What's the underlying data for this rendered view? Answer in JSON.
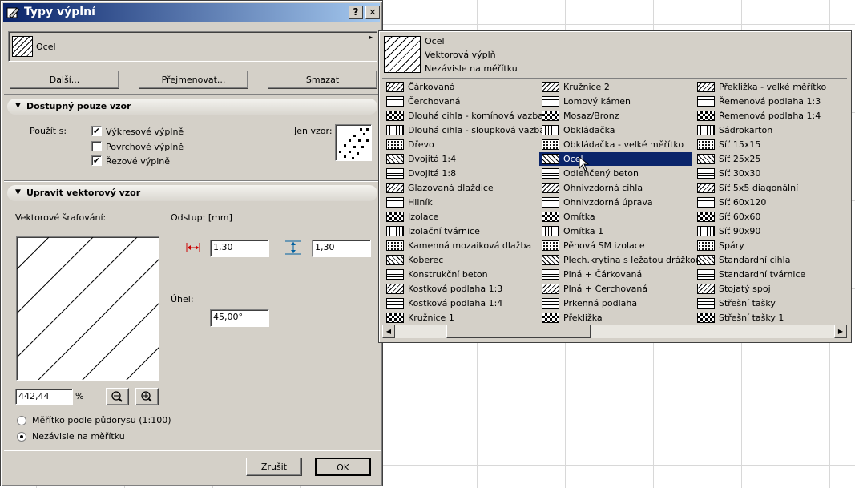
{
  "window": {
    "title": "Typy výplní",
    "help_btn": "?",
    "close_btn": "✕"
  },
  "current_fill": {
    "name": "Ocel"
  },
  "buttons": {
    "other": "Další...",
    "rename": "Přejmenovat...",
    "delete": "Smazat",
    "cancel": "Zrušit",
    "ok": "OK"
  },
  "section_pattern": {
    "header": "Dostupný pouze vzor",
    "use_with": "Použít s:",
    "options": [
      {
        "label": "Výkresové výplně",
        "checked": true
      },
      {
        "label": "Povrchové výplně",
        "checked": false
      },
      {
        "label": "Řezové výplně",
        "checked": true
      }
    ],
    "pattern_only": "Jen vzor:"
  },
  "section_vector": {
    "header": "Upravit vektorový vzor",
    "hatching_label": "Vektorové šrafování:",
    "offset_label": "Odstup: [mm]",
    "offset_x": "1,30",
    "offset_y": "1,30",
    "angle_label": "Úhel:",
    "angle": "45,00°",
    "zoom": "442,44",
    "zoom_unit": "%",
    "radio_scale": "Měřítko podle půdorysu (1:100)",
    "radio_independent": "Nezávisle na měřítku",
    "independent_selected": true
  },
  "popup": {
    "selected_name": "Ocel",
    "selected_type": "Vektorová výplň",
    "selected_scale": "Nezávisle na měřítku",
    "columns": [
      [
        "Čárkovaná",
        "Čerchovaná",
        "Dlouhá cihla - komínová vazba",
        "Dlouhá cihla - sloupková vazba",
        "Dřevo",
        "Dvojitá 1:4",
        "Dvojitá 1:8",
        "Glazovaná dlaždice",
        "Hliník",
        "Izolace",
        "Izolační tvárnice",
        "Kamenná mozaiková dlažba",
        "Koberec",
        "Konstrukční beton",
        "Kostková podlaha 1:3",
        "Kostková podlaha 1:4",
        "Kružnice 1"
      ],
      [
        "Kružnice 2",
        "Lomový kámen",
        "Mosaz/Bronz",
        "Obkládačka",
        "Obkládačka - velké měřítko",
        "Ocel",
        "Odlehčený beton",
        "Ohnivzdorná cihla",
        "Ohnivzdorná úprava",
        "Omítka",
        "Omítka 1",
        "Pěnová SM izolace",
        "Plech.krytina s ležatou drážkou",
        "Plná + Čárkovaná",
        "Plná + Čerchovaná",
        "Prkenná podlaha",
        "Překližka"
      ],
      [
        "Překližka - velké měřítko",
        "Řemenová podlaha 1:3",
        "Řemenová podlaha 1:4",
        "Sádrokarton",
        "Síť 15x15",
        "Síť 25x25",
        "Síť 30x30",
        "Síť 5x5 diagonální",
        "Síť 60x120",
        "Síť 60x60",
        "Síť 90x90",
        "Spáry",
        "Standardní cihla",
        "Standardní tvárnice",
        "Stojatý spoj",
        "Střešní tašky",
        "Střešní tašky 1"
      ]
    ],
    "selected_index": [
      1,
      5
    ]
  }
}
